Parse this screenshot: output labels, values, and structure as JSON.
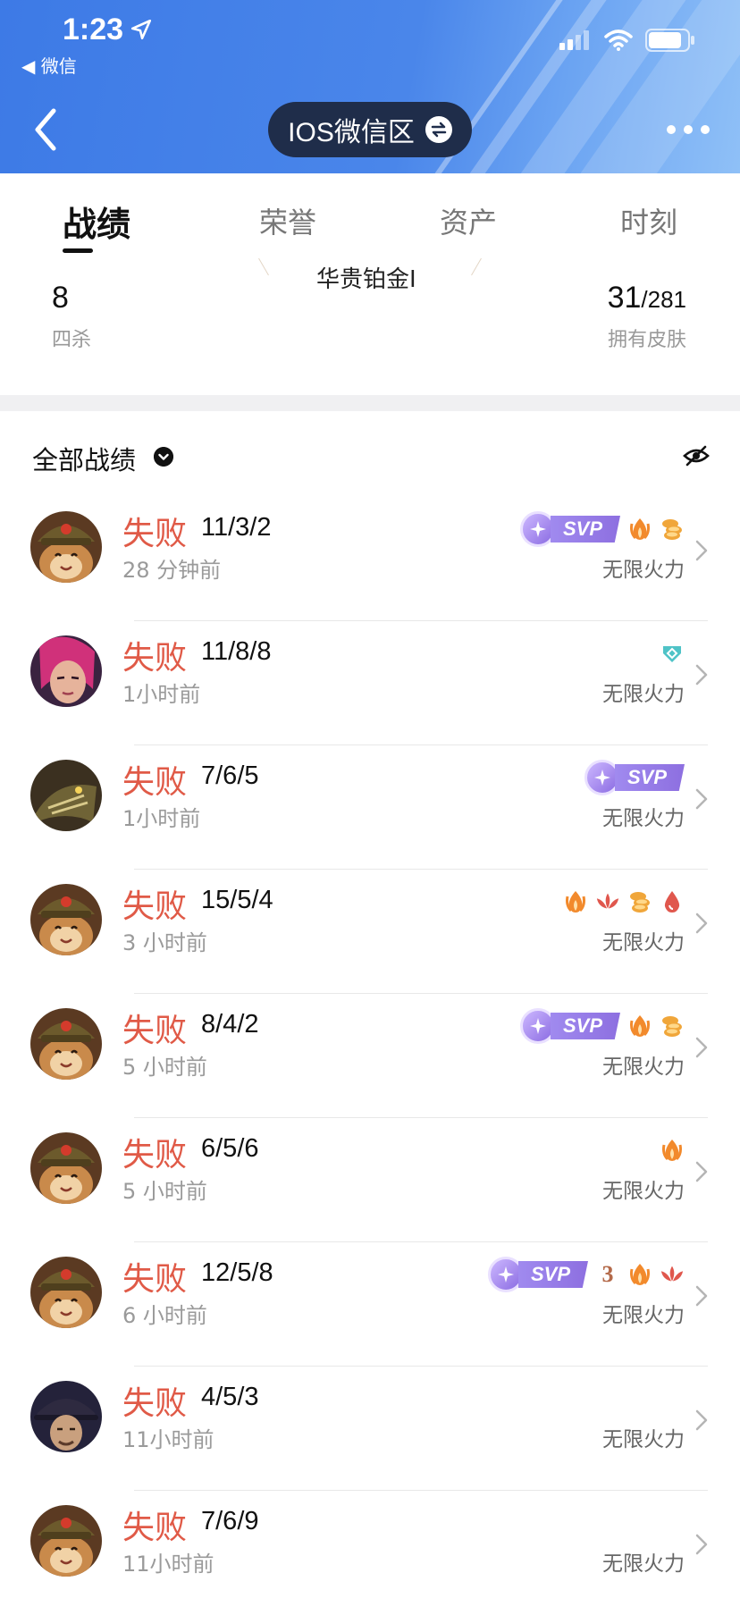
{
  "status_bar": {
    "time": "1:23",
    "back_app": "◀ 微信"
  },
  "nav": {
    "server": "IOS微信区"
  },
  "tabs": [
    "战绩",
    "荣誉",
    "资产",
    "时刻"
  ],
  "stats": {
    "rank_partial": "华贵铂金Ⅰ",
    "left_value": "8",
    "left_label": "四杀",
    "right_value": "31",
    "right_total": "/281",
    "right_label": "拥有皮肤"
  },
  "filter": {
    "label": "全部战绩"
  },
  "matches": [
    {
      "result": "失败",
      "kda": "11/3/2",
      "time": "28 分钟前",
      "mode": "无限火力",
      "hero": "teemo",
      "badges": [
        "svp",
        "fire",
        "coin"
      ]
    },
    {
      "result": "失败",
      "kda": "11/8/8",
      "time": "1小时前",
      "mode": "无限火力",
      "hero": "vi",
      "badges": [
        "shield"
      ]
    },
    {
      "result": "失败",
      "kda": "7/6/5",
      "time": "1小时前",
      "mode": "无限火力",
      "hero": "renekton",
      "badges": [
        "svp"
      ]
    },
    {
      "result": "失败",
      "kda": "15/5/4",
      "time": "3 小时前",
      "mode": "无限火力",
      "hero": "teemo",
      "badges": [
        "fire",
        "lotus",
        "coin",
        "drop"
      ]
    },
    {
      "result": "失败",
      "kda": "8/4/2",
      "time": "5 小时前",
      "mode": "无限火力",
      "hero": "teemo",
      "badges": [
        "svp",
        "fire",
        "coin"
      ]
    },
    {
      "result": "失败",
      "kda": "6/5/6",
      "time": "5 小时前",
      "mode": "无限火力",
      "hero": "teemo",
      "badges": [
        "fire"
      ]
    },
    {
      "result": "失败",
      "kda": "12/5/8",
      "time": "6 小时前",
      "mode": "无限火力",
      "hero": "teemo",
      "badges": [
        "svp",
        "triple",
        "fire",
        "lotus"
      ]
    },
    {
      "result": "失败",
      "kda": "4/5/3",
      "time": "11小时前",
      "mode": "无限火力",
      "hero": "twisted-fate",
      "badges": []
    },
    {
      "result": "失败",
      "kda": "7/6/9",
      "time": "11小时前",
      "mode": "无限火力",
      "hero": "teemo",
      "badges": []
    }
  ],
  "svp_label": "SVP",
  "triple_label": "3",
  "colors": {
    "loss": "#e05a47",
    "header": "#3d7ae6",
    "pill": "#1f2d4a",
    "svp": "#8d6fe0",
    "fire": "#f28a2c",
    "coin": "#f0a63a",
    "lotus": "#e0574d",
    "shield": "#4fc3c7"
  }
}
